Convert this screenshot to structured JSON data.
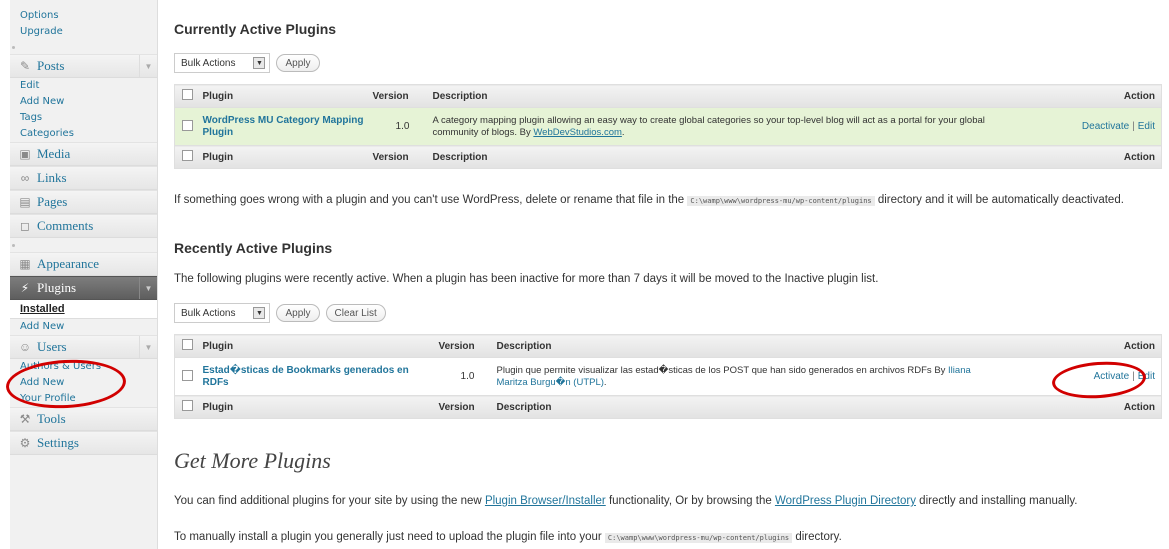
{
  "sidebar": {
    "settings_sub": [
      "Options",
      "Upgrade"
    ],
    "posts": {
      "label": "Posts",
      "sub": [
        "Edit",
        "Add New",
        "Tags",
        "Categories"
      ]
    },
    "media": "Media",
    "links": "Links",
    "pages": "Pages",
    "comments": "Comments",
    "appearance": "Appearance",
    "plugins": {
      "label": "Plugins",
      "installed": "Installed",
      "add_new": "Add New"
    },
    "users": {
      "label": "Users",
      "sub": [
        "Authors & Users",
        "Add New",
        "Your Profile"
      ]
    },
    "tools": "Tools",
    "settings": "Settings"
  },
  "active": {
    "title": "Currently Active Plugins",
    "bulk": "Bulk Actions",
    "apply": "Apply",
    "cols": {
      "plugin": "Plugin",
      "version": "Version",
      "description": "Description",
      "action": "Action"
    },
    "row": {
      "name": "WordPress MU Category Mapping Plugin",
      "version": "1.0",
      "desc": "A category mapping plugin allowing an easy way to create global categories so your top-level blog will act as a portal for your global community of blogs. By",
      "author": "WebDevStudios.com",
      "desc_end": ".",
      "deactivate": "Deactivate",
      "edit": "Edit"
    }
  },
  "warning": {
    "before": "If something goes wrong with a plugin and you can't use WordPress, delete or rename that file in the",
    "path": "C:\\wamp\\www\\wordpress-mu/wp-content/plugins",
    "after": "directory and it will be automatically deactivated."
  },
  "recent": {
    "title": "Recently Active Plugins",
    "info": "The following plugins were recently active. When a plugin has been inactive for more than 7 days it will be moved to the Inactive plugin list.",
    "bulk": "Bulk Actions",
    "apply": "Apply",
    "clear": "Clear List",
    "cols": {
      "plugin": "Plugin",
      "version": "Version",
      "description": "Description",
      "action": "Action"
    },
    "row": {
      "name": "Estad�sticas de Bookmarks generados en RDFs",
      "version": "1.0",
      "desc": "Plugin que permite visualizar las estad�sticas de los POST que han sido generados en archivos RDFs By",
      "author": "Iliana Maritza Burgu�n (UTPL)",
      "desc_end": ".",
      "activate": "Activate",
      "edit": "Edit"
    }
  },
  "more": {
    "title": "Get More Plugins",
    "p1_before": "You can find additional plugins for your site by using the new",
    "p1_link1": "Plugin Browser/Installer",
    "p1_mid": "functionality, Or by browsing the",
    "p1_link2": "WordPress Plugin Directory",
    "p1_after": "directly and installing manually.",
    "p2_before": "To manually install a plugin you generally just need to upload the plugin file into your",
    "p2_path": "C:\\wamp\\www\\wordpress-mu/wp-content/plugins",
    "p2_after": "directory."
  },
  "colors": {
    "link": "#21759b",
    "active_row": "#e6f3d6",
    "highlight": "#d10000"
  }
}
